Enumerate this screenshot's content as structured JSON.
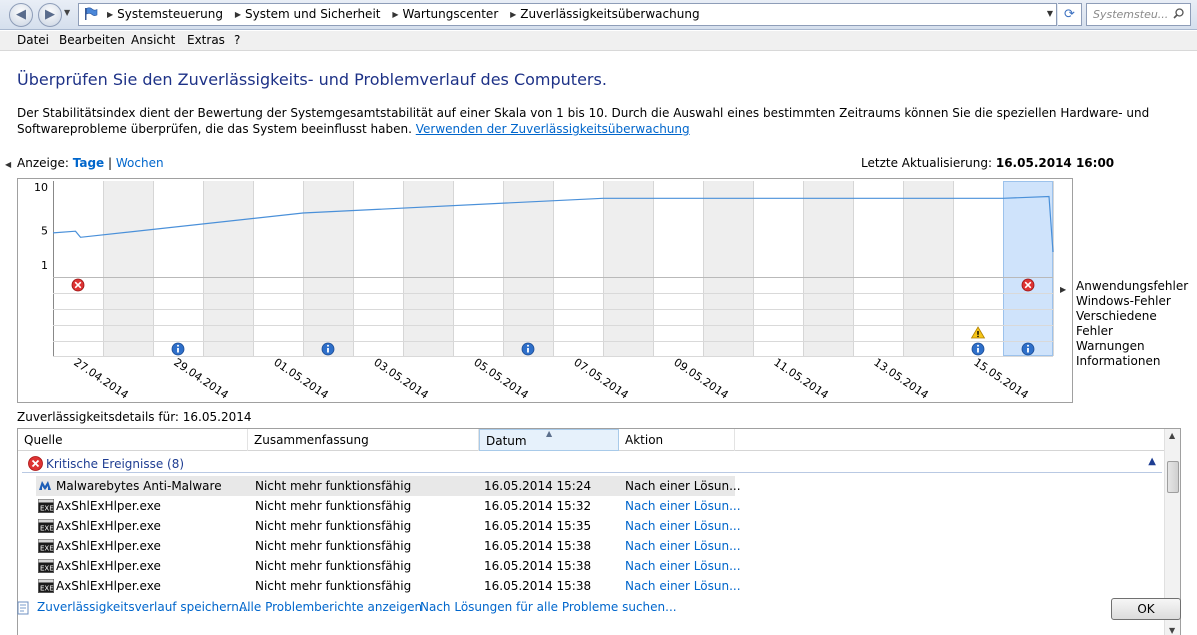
{
  "address": {
    "breadcrumbs": [
      "Systemsteuerung",
      "System und Sicherheit",
      "Wartungscenter",
      "Zuverlässigkeitsüberwachung"
    ],
    "search_placeholder": "Systemsteu..."
  },
  "menu": [
    "Datei",
    "Bearbeiten",
    "Ansicht",
    "Extras",
    "?"
  ],
  "heading": "Überprüfen Sie den Zuverlässigkeits- und Problemverlauf des Computers.",
  "description": "Der Stabilitätsindex dient der Bewertung der Systemgesamtstabilität auf einer Skala von 1 bis 10. Durch die Auswahl eines bestimmten Zeitraums können Sie die speziellen Hardware- und Softwareprobleme überprüfen, die das System beeinflusst haben.",
  "description_link": "Verwenden der Zuverlässigkeitsüberwachung",
  "view": {
    "label": "Anzeige:",
    "days": "Tage",
    "separator": "|",
    "weeks": "Wochen"
  },
  "last_update": {
    "label": "Letzte Aktualisierung:",
    "value": "16.05.2014 16:00"
  },
  "chart_data": {
    "type": "line",
    "y_ticks": [
      "10",
      "5",
      "1"
    ],
    "ylim": [
      1,
      10
    ],
    "x_tick_labels": [
      "27.04.2014",
      "29.04.2014",
      "01.05.2014",
      "03.05.2014",
      "05.05.2014",
      "07.05.2014",
      "09.05.2014",
      "11.05.2014",
      "13.05.2014",
      "15.05.2014"
    ],
    "stability_index": [
      {
        "day": 0,
        "value": 4.7
      },
      {
        "day": 0.45,
        "value": 4.9
      },
      {
        "day": 0.55,
        "value": 4.2
      },
      {
        "day": 5,
        "value": 7.0
      },
      {
        "day": 11.0,
        "value": 8.7
      },
      {
        "day": 19.0,
        "value": 8.7
      },
      {
        "day": 19.92,
        "value": 8.9
      },
      {
        "day": 20.0,
        "value": 2.5
      }
    ],
    "row_labels": [
      "Anwendungsfehler",
      "Windows-Fehler",
      "Verschiedene Fehler",
      "Warnungen",
      "Informationen"
    ],
    "events": [
      {
        "day": 0.5,
        "row": 0,
        "kind": "error"
      },
      {
        "day": 19.5,
        "row": 0,
        "kind": "error"
      },
      {
        "day": 18.5,
        "row": 3,
        "kind": "warning"
      },
      {
        "day": 2.5,
        "row": 4,
        "kind": "info"
      },
      {
        "day": 5.5,
        "row": 4,
        "kind": "info"
      },
      {
        "day": 9.5,
        "row": 4,
        "kind": "info"
      },
      {
        "day": 18.5,
        "row": 4,
        "kind": "info"
      },
      {
        "day": 19.5,
        "row": 4,
        "kind": "info"
      }
    ],
    "selected_day": 19,
    "days_count": 20
  },
  "details": {
    "title": "Zuverlässigkeitsdetails für: 16.05.2014",
    "columns": [
      "Quelle",
      "Zusammenfassung",
      "Datum",
      "Aktion"
    ],
    "group_label": "Kritische Ereignisse (8)",
    "rows": [
      {
        "source": "Malwarebytes Anti-Malware",
        "summary": "Nicht mehr funktionsfähig",
        "date": "16.05.2014 15:24",
        "action": "Nach einer Lösun...",
        "icon": "malwarebytes-icon"
      },
      {
        "source": "AxShlExHlper.exe",
        "summary": "Nicht mehr funktionsfähig",
        "date": "16.05.2014 15:32",
        "action": "Nach einer Lösun...",
        "icon": "exe-icon"
      },
      {
        "source": "AxShlExHlper.exe",
        "summary": "Nicht mehr funktionsfähig",
        "date": "16.05.2014 15:35",
        "action": "Nach einer Lösun...",
        "icon": "exe-icon"
      },
      {
        "source": "AxShlExHlper.exe",
        "summary": "Nicht mehr funktionsfähig",
        "date": "16.05.2014 15:38",
        "action": "Nach einer Lösun...",
        "icon": "exe-icon"
      },
      {
        "source": "AxShlExHlper.exe",
        "summary": "Nicht mehr funktionsfähig",
        "date": "16.05.2014 15:38",
        "action": "Nach einer Lösun...",
        "icon": "exe-icon"
      },
      {
        "source": "AxShlExHlper.exe",
        "summary": "Nicht mehr funktionsfähig",
        "date": "16.05.2014 15:38",
        "action": "Nach einer Lösun...",
        "icon": "exe-icon"
      }
    ]
  },
  "footer": {
    "save_history": "Zuverlässigkeitsverlauf speichern...",
    "all_reports": "Alle Problemberichte anzeigen",
    "check_solutions": "Nach Lösungen für alle Probleme suchen...",
    "ok": "OK"
  },
  "colors": {
    "heading": "#1e3287",
    "link": "#0066cc",
    "line": "#4a90d9",
    "selected_column": "#cfe3fb"
  }
}
